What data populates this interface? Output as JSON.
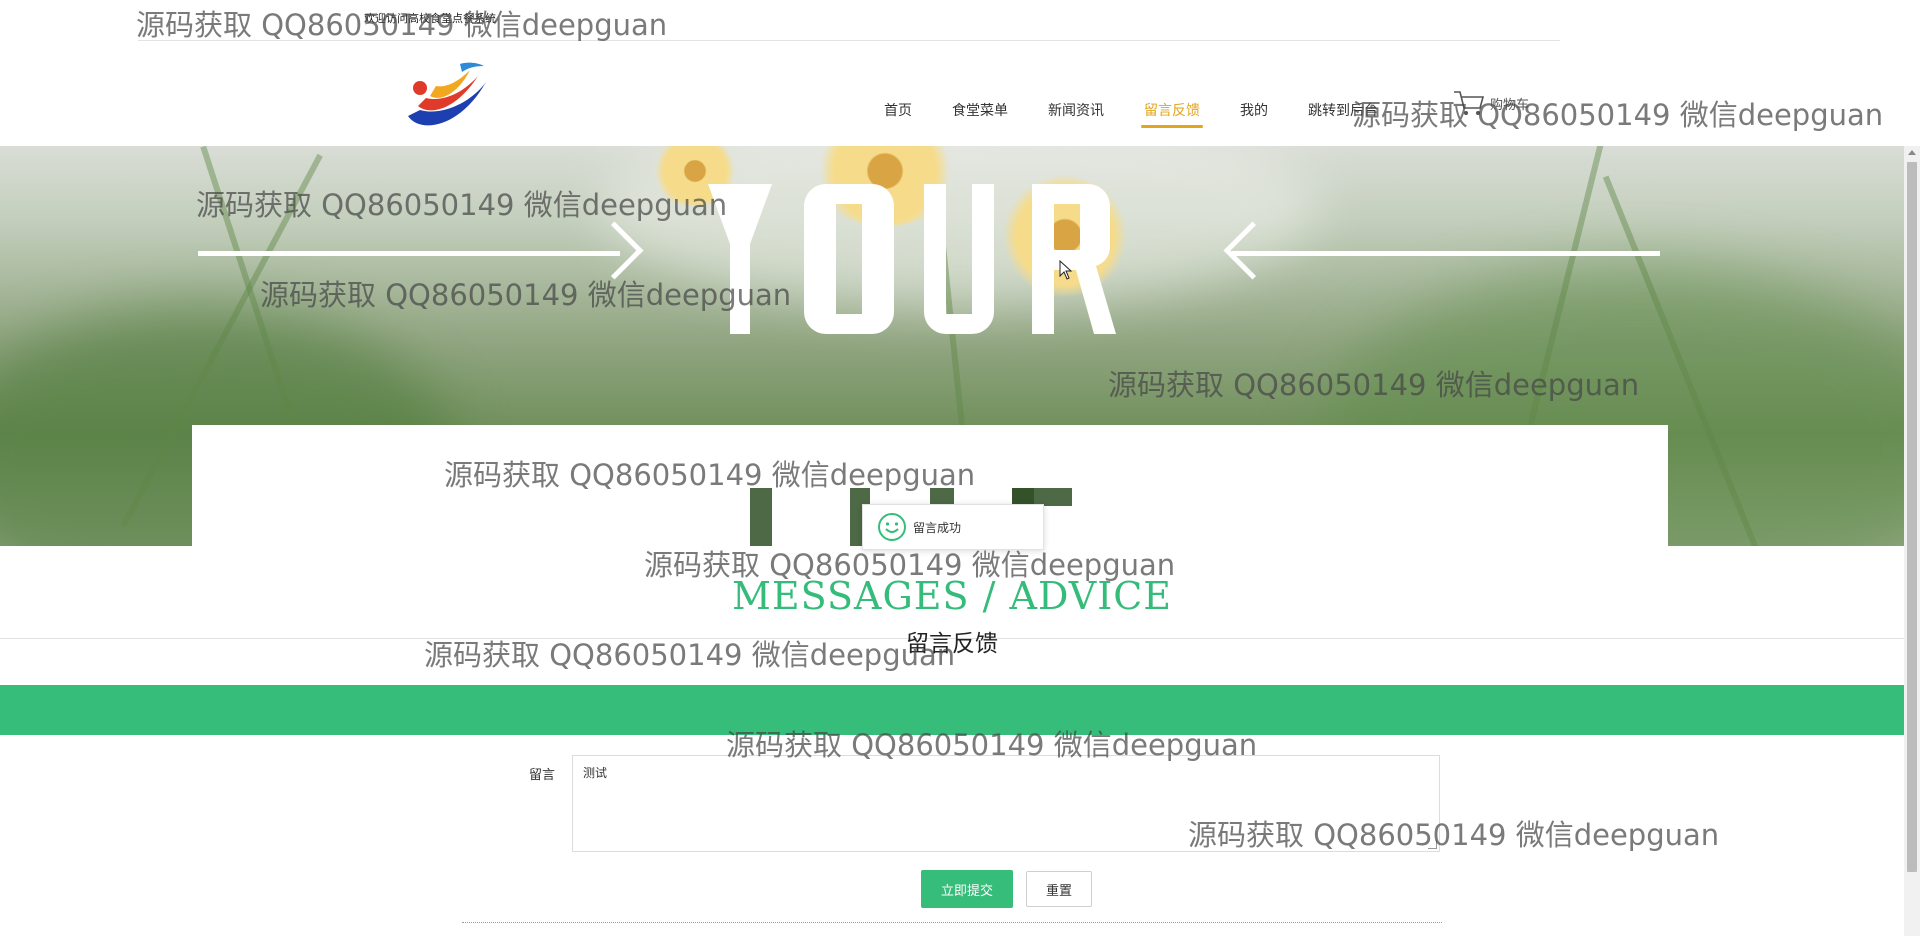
{
  "topbar": {
    "welcome": "欢迎访问高校食堂点餐系统"
  },
  "nav": {
    "items": [
      "首页",
      "食堂菜单",
      "新闻资讯",
      "留言反馈",
      "我的",
      "跳转到后台"
    ],
    "active_index": 3,
    "cart_label": "购物车"
  },
  "toast": {
    "text": "留言成功"
  },
  "section": {
    "title_en": "MESSAGES / ADVICE",
    "title_cn": "留言反馈"
  },
  "form": {
    "label": "留言",
    "textarea_value": "测试",
    "submit_label": "立即提交",
    "reset_label": "重置"
  },
  "watermark": "源码获取 QQ86050149 微信deepguan",
  "colors": {
    "accent": "#35bd79",
    "nav_active": "#e2a51b"
  }
}
